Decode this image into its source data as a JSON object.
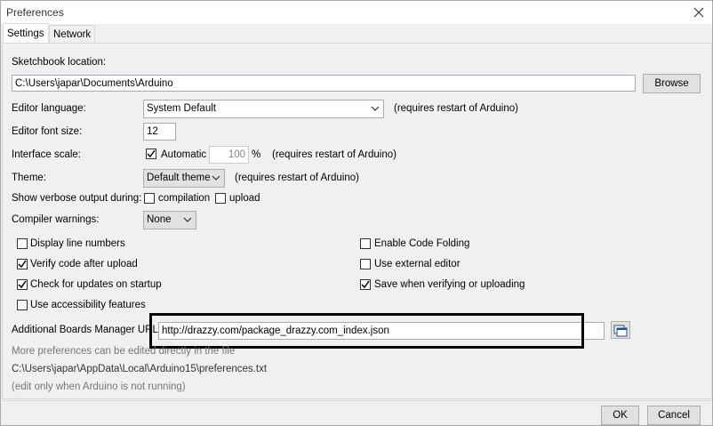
{
  "window": {
    "title": "Preferences"
  },
  "tabs": [
    {
      "label": "Settings"
    },
    {
      "label": "Network"
    }
  ],
  "settings": {
    "sketchbook_label": "Sketchbook location:",
    "sketchbook_path": "C:\\Users\\japar\\Documents\\Arduino",
    "browse_label": "Browse",
    "editor_language_label": "Editor language:",
    "editor_language_value": "System Default",
    "restart_note": "(requires restart of Arduino)",
    "font_size_label": "Editor font size:",
    "font_size_value": "12",
    "interface_scale_label": "Interface scale:",
    "automatic_label": "Automatic",
    "scale_value": "100",
    "percent": "%",
    "theme_label": "Theme:",
    "theme_value": "Default theme",
    "verbose_label": "Show verbose output during:",
    "compilation_label": "compilation",
    "upload_label": "upload",
    "compiler_warnings_label": "Compiler warnings:",
    "compiler_warnings_value": "None",
    "display_line_numbers": "Display line numbers",
    "enable_code_folding": "Enable Code Folding",
    "verify_after_upload": "Verify code after upload",
    "use_external_editor": "Use external editor",
    "check_updates": "Check for updates on startup",
    "save_when_verifying": "Save when verifying or uploading",
    "accessibility": "Use accessibility features",
    "boards_url_label": "Additional Boards Manager URLs:",
    "boards_url_value": "http://drazzy.com/package_drazzy.com_index.json",
    "more_prefs": "More preferences can be edited directly in the file",
    "prefs_path": "C:\\Users\\japar\\AppData\\Local\\Arduino15\\preferences.txt",
    "edit_note": "(edit only when Arduino is not running)"
  },
  "checkboxes": {
    "automatic": true,
    "compilation": false,
    "upload": false,
    "display_line_numbers": false,
    "enable_code_folding": false,
    "verify_after_upload": true,
    "use_external_editor": false,
    "check_updates": true,
    "save_when_verifying": true,
    "accessibility": false
  },
  "footer": {
    "ok_label": "OK",
    "cancel_label": "Cancel"
  }
}
